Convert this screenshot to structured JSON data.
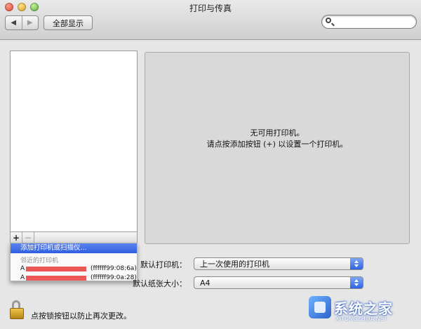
{
  "window": {
    "title": "打印与传真"
  },
  "toolbar": {
    "back_icon": "◀",
    "forward_icon": "▶",
    "show_all_label": "全部显示",
    "search_value": ""
  },
  "printer_list": {
    "add_label": "+",
    "remove_label": "−",
    "menu": {
      "selected_item": "添加打印机或扫描仪...",
      "section_label": "邻近的打印机",
      "printers": [
        {
          "name": "A",
          "id": "(ffffff99:08:6a)"
        },
        {
          "name": "A",
          "id": "(ffffff99:0a:28)"
        }
      ]
    }
  },
  "detail": {
    "line1": "无可用打印机。",
    "line2": "请点按添加按钮 (+) 以设置一个打印机。"
  },
  "defaults": {
    "printer_label": "默认打印机：",
    "printer_value": "上一次使用的打印机",
    "paper_label": "默认纸张大小：",
    "paper_value": "A4"
  },
  "lock": {
    "text": "点按锁按钮以防止再次更改。"
  },
  "watermark": {
    "brand": "系统之家",
    "url": "XITONGZHIJIA.NET"
  },
  "colors": {
    "selection": "#2e5fe0",
    "redaction": "#ec5757"
  }
}
